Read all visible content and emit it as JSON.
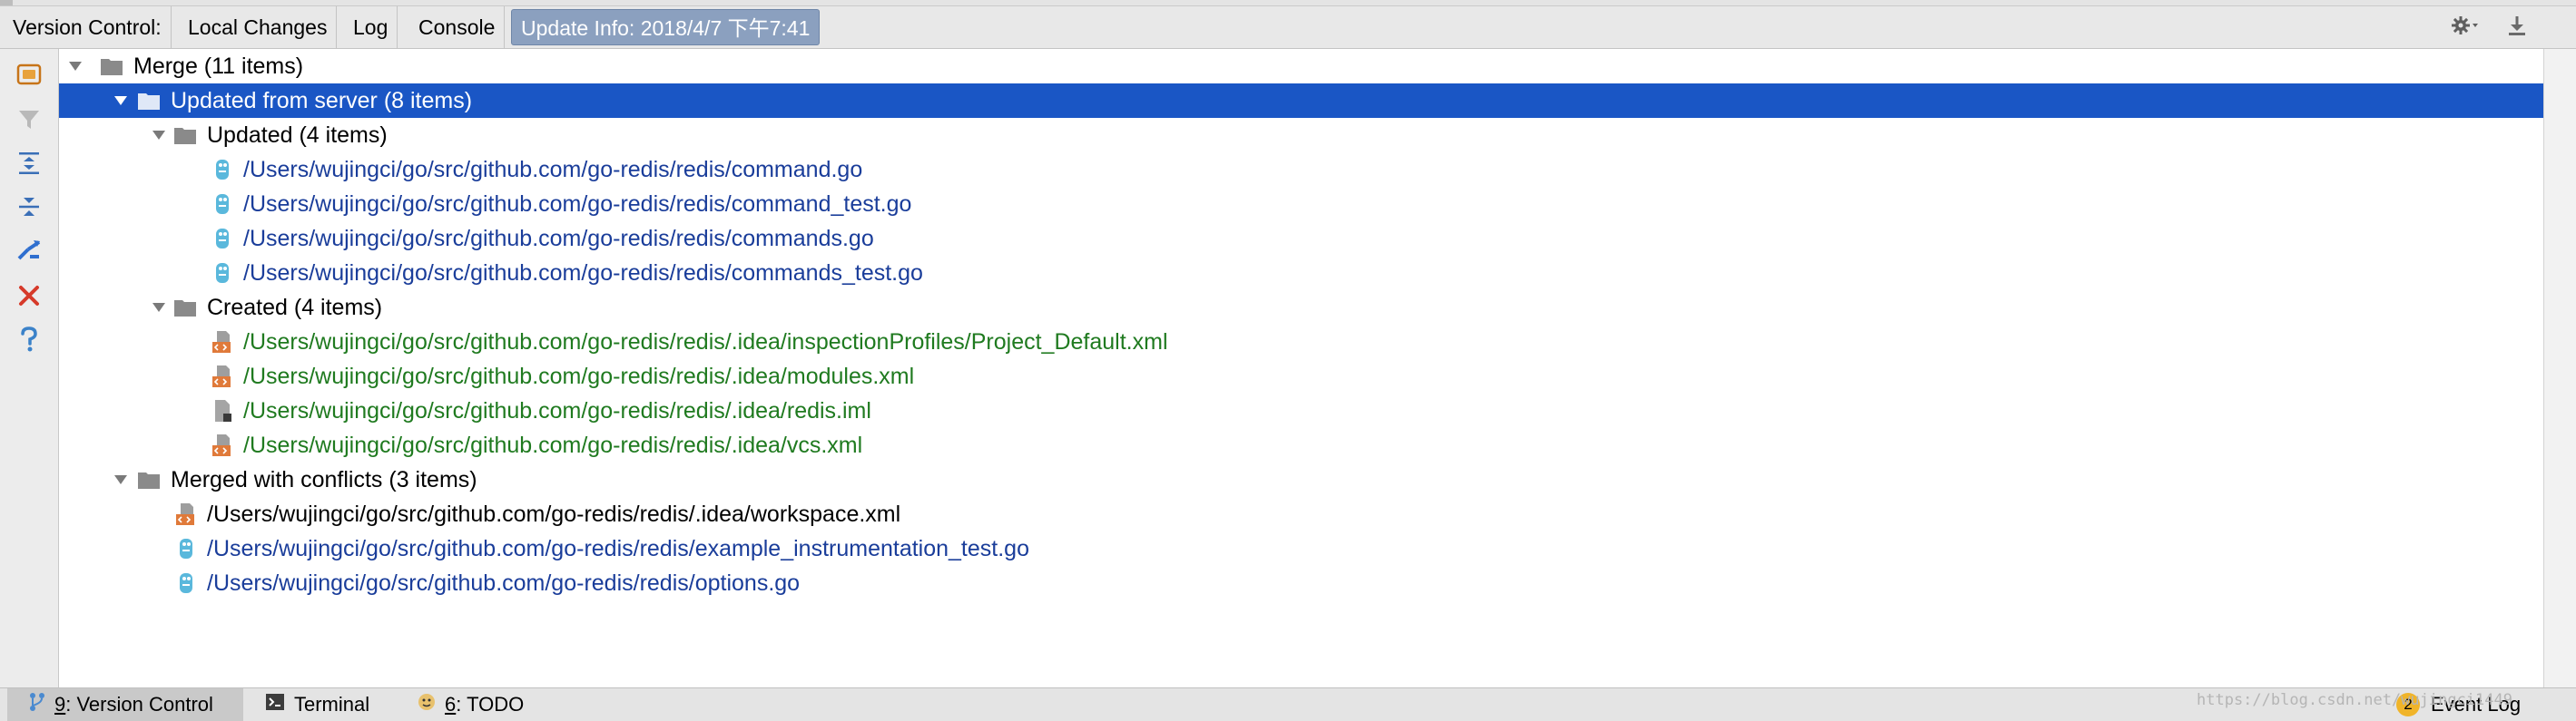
{
  "tabs": {
    "label": "Version Control:",
    "local_changes": "Local Changes",
    "log": "Log",
    "console": "Console",
    "update_info": "Update Info: 2018/4/7 下午7:41"
  },
  "toolbar_right": {
    "settings_icon": "gear-icon",
    "download_icon": "download-icon"
  },
  "left_toolbar": [
    "group-icon",
    "filter-icon",
    "expand-all-icon",
    "collapse-all-icon",
    "merge-icon",
    "close-icon",
    "help-icon"
  ],
  "tree": {
    "root": "Merge (11 items)",
    "updated_from_server": "Updated from server (8 items)",
    "updated": "Updated (4 items)",
    "updated_files": [
      "/Users/wujingci/go/src/github.com/go-redis/redis/command.go",
      "/Users/wujingci/go/src/github.com/go-redis/redis/command_test.go",
      "/Users/wujingci/go/src/github.com/go-redis/redis/commands.go",
      "/Users/wujingci/go/src/github.com/go-redis/redis/commands_test.go"
    ],
    "created": "Created (4 items)",
    "created_files": [
      "/Users/wujingci/go/src/github.com/go-redis/redis/.idea/inspectionProfiles/Project_Default.xml",
      "/Users/wujingci/go/src/github.com/go-redis/redis/.idea/modules.xml",
      "/Users/wujingci/go/src/github.com/go-redis/redis/.idea/redis.iml",
      "/Users/wujingci/go/src/github.com/go-redis/redis/.idea/vcs.xml"
    ],
    "conflicts": "Merged with conflicts (3 items)",
    "conflict_files": [
      "/Users/wujingci/go/src/github.com/go-redis/redis/.idea/workspace.xml",
      "/Users/wujingci/go/src/github.com/go-redis/redis/example_instrumentation_test.go",
      "/Users/wujingci/go/src/github.com/go-redis/redis/options.go"
    ]
  },
  "statusbar": {
    "version_control_num": "9",
    "version_control": ": Version Control",
    "terminal": "Terminal",
    "todo_num": "6",
    "todo": ": TODO",
    "watermark": "https://blog.csdn.net/wujingci1449",
    "event_count": "2",
    "event_log": "Event Log"
  },
  "colors": {
    "selection": "#1a56c5",
    "updated_text": "#1a3d9a",
    "created_text": "#1f7a1f",
    "active_tab": "#8ba0bf"
  }
}
